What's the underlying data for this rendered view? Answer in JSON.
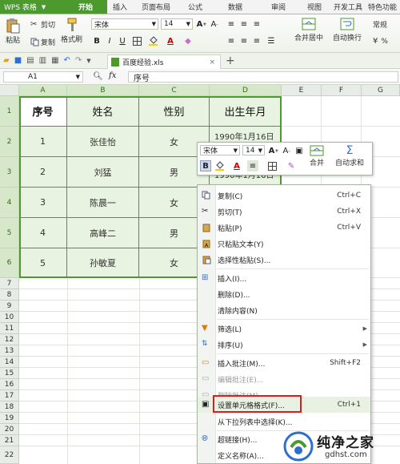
{
  "app": {
    "name": "WPS 表格",
    "accent": "#4c9a2e"
  },
  "ribbon_tabs": [
    "开始",
    "插入",
    "页面布局",
    "公式",
    "数据",
    "审阅",
    "视图",
    "开发工具",
    "特色功能"
  ],
  "ribbon": {
    "paste": "粘贴",
    "cut": "剪切",
    "copy": "复制",
    "format_painter": "格式刷",
    "font_name": "宋体",
    "font_size": "14",
    "merge_center": "合并居中",
    "auto_wrap": "自动换行",
    "general": "常规"
  },
  "document": {
    "filename": "百度经验.xls"
  },
  "formula_bar": {
    "cell_ref": "A1",
    "fx": "fx",
    "content": "序号"
  },
  "columns": [
    "A",
    "B",
    "C",
    "D",
    "E",
    "F",
    "G"
  ],
  "rows": [
    "1",
    "2",
    "3",
    "4",
    "5",
    "6",
    "7",
    "8",
    "9",
    "10",
    "11",
    "12",
    "13",
    "14",
    "15",
    "16",
    "17",
    "18",
    "19",
    "20",
    "21",
    "22"
  ],
  "table": {
    "headers": [
      "序号",
      "姓名",
      "性别",
      "出生年月"
    ],
    "rows": [
      [
        "1",
        "张佳怡",
        "女",
        "1990年1月16日"
      ],
      [
        "2",
        "刘猛",
        "男",
        "1990年1月16日"
      ],
      [
        "3",
        "陈晨一",
        "女",
        ""
      ],
      [
        "4",
        "高峰二",
        "男",
        ""
      ],
      [
        "5",
        "孙敏夏",
        "女",
        ""
      ]
    ]
  },
  "mini_toolbar": {
    "font_name": "宋体",
    "font_size": "14",
    "merge": "合并",
    "autosum": "自动求和"
  },
  "context_menu": [
    {
      "label": "复制(C)",
      "shortcut": "Ctrl+C",
      "icon": "copy-icon"
    },
    {
      "label": "剪切(T)",
      "shortcut": "Ctrl+X",
      "icon": "scissors-icon"
    },
    {
      "label": "粘贴(P)",
      "shortcut": "Ctrl+V",
      "icon": "paste-icon"
    },
    {
      "label": "只粘贴文本(Y)",
      "shortcut": "",
      "icon": "paste-text-icon"
    },
    {
      "label": "选择性粘贴(S)...",
      "shortcut": "",
      "icon": "paste-special-icon"
    },
    {
      "label": "插入(I)...",
      "shortcut": "",
      "icon": "insert-icon"
    },
    {
      "label": "删除(D)...",
      "shortcut": "",
      "icon": ""
    },
    {
      "label": "清除内容(N)",
      "shortcut": "",
      "icon": ""
    },
    {
      "label": "筛选(L)",
      "shortcut": "",
      "icon": "filter-icon"
    },
    {
      "label": "排序(U)",
      "shortcut": "",
      "icon": "sort-icon"
    },
    {
      "label": "插入批注(M)...",
      "shortcut": "Shift+F2",
      "icon": "comment-icon"
    },
    {
      "label": "编辑批注(E)...",
      "shortcut": "",
      "icon": "edit-comment-icon"
    },
    {
      "label": "删除批注(M)",
      "shortcut": "",
      "icon": "delete-comment-icon"
    },
    {
      "label": "设置单元格格式(F)...",
      "shortcut": "Ctrl+1",
      "icon": "format-cells-icon"
    },
    {
      "label": "从下拉列表中选择(K)...",
      "shortcut": "",
      "icon": ""
    },
    {
      "label": "超链接(H)...",
      "shortcut": "",
      "icon": "hyperlink-icon"
    },
    {
      "label": "定义名称(A)...",
      "shortcut": "",
      "icon": ""
    }
  ],
  "watermark": {
    "title": "纯净之家",
    "url": "gdhst.com"
  }
}
